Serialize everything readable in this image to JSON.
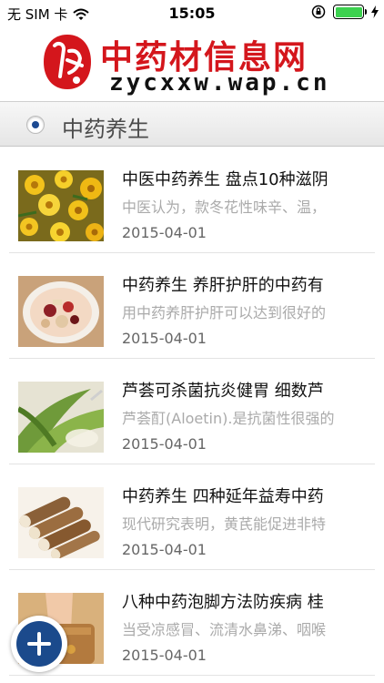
{
  "status_bar": {
    "carrier": "无 SIM 卡",
    "time": "15:05",
    "battery_color": "#3cd14f"
  },
  "header": {
    "logo_title": "中药材信息网",
    "logo_subtitle": "zycxxw.wap.cn",
    "brand_color": "#d4161c"
  },
  "section": {
    "title": "中药养生"
  },
  "articles": [
    {
      "title": "中医中药养生 盘点10种滋阴",
      "desc": "中医认为，款冬花性味辛、温，",
      "date": "2015-04-01",
      "thumb": "yellow-flowers"
    },
    {
      "title": "中药养生 养肝护肝的中药有",
      "desc": "用中药养肝护肝可以达到很好的",
      "date": "2015-04-01",
      "thumb": "herbal-soup-bowl"
    },
    {
      "title": "芦荟可杀菌抗炎健胃 细数芦",
      "desc": "芦荟酊(Aloetin).是抗菌性很强的",
      "date": "2015-04-01",
      "thumb": "aloe-leaves"
    },
    {
      "title": "中药养生 四种延年益寿中药",
      "desc": "现代研究表明，黄芪能促进非特",
      "date": "2015-04-01",
      "thumb": "yam-slices"
    },
    {
      "title": "八种中药泡脚方法防疾病 桂",
      "desc": "当受凉感冒、流清水鼻涕、咽喉",
      "date": "2015-04-01",
      "thumb": "foot-soak"
    }
  ]
}
